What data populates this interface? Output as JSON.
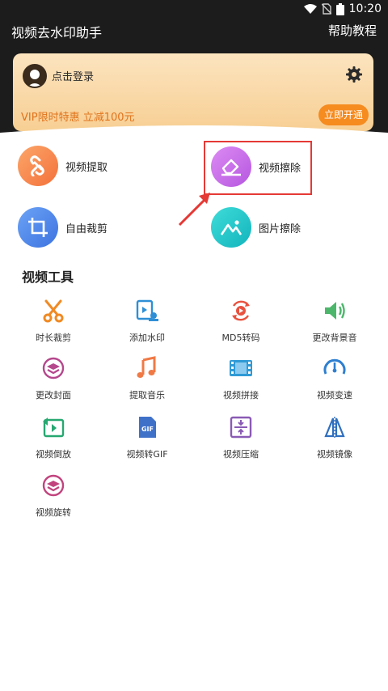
{
  "status": {
    "time": "10:20"
  },
  "appbar": {
    "title": "视频去水印助手",
    "help": "帮助教程"
  },
  "vip_card": {
    "login": "点击登录",
    "promo": "VIP限时特惠 立减100元",
    "open_btn": "立即开通"
  },
  "features": [
    {
      "label": "视频提取",
      "icon": "link-icon",
      "color": "#f7884a"
    },
    {
      "label": "视频擦除",
      "icon": "eraser-icon",
      "color": "#c769e6"
    },
    {
      "label": "自由裁剪",
      "icon": "crop-icon",
      "color": "#4d89ef"
    },
    {
      "label": "图片擦除",
      "icon": "image-icon",
      "color": "#1bc7c8"
    }
  ],
  "section": {
    "title": "视频工具"
  },
  "tools": [
    {
      "label": "时长裁剪",
      "icon": "scissors-icon"
    },
    {
      "label": "添加水印",
      "icon": "add-watermark-icon"
    },
    {
      "label": "MD5转码",
      "icon": "md5-icon"
    },
    {
      "label": "更改背景音",
      "icon": "speaker-icon"
    },
    {
      "label": "更改封面",
      "icon": "layers-icon"
    },
    {
      "label": "提取音乐",
      "icon": "music-note-icon"
    },
    {
      "label": "视频拼接",
      "icon": "film-icon"
    },
    {
      "label": "视频变速",
      "icon": "speedometer-icon"
    },
    {
      "label": "视频倒放",
      "icon": "reverse-play-icon"
    },
    {
      "label": "视频转GIF",
      "icon": "gif-icon"
    },
    {
      "label": "视频压缩",
      "icon": "compress-icon"
    },
    {
      "label": "视频镜像",
      "icon": "mirror-icon"
    },
    {
      "label": "视频旋转",
      "icon": "rotate-icon"
    }
  ],
  "colors": {
    "accent_orange": "#f68b1f",
    "highlight_red": "#e53935",
    "header_bg": "#1c1c1c"
  }
}
